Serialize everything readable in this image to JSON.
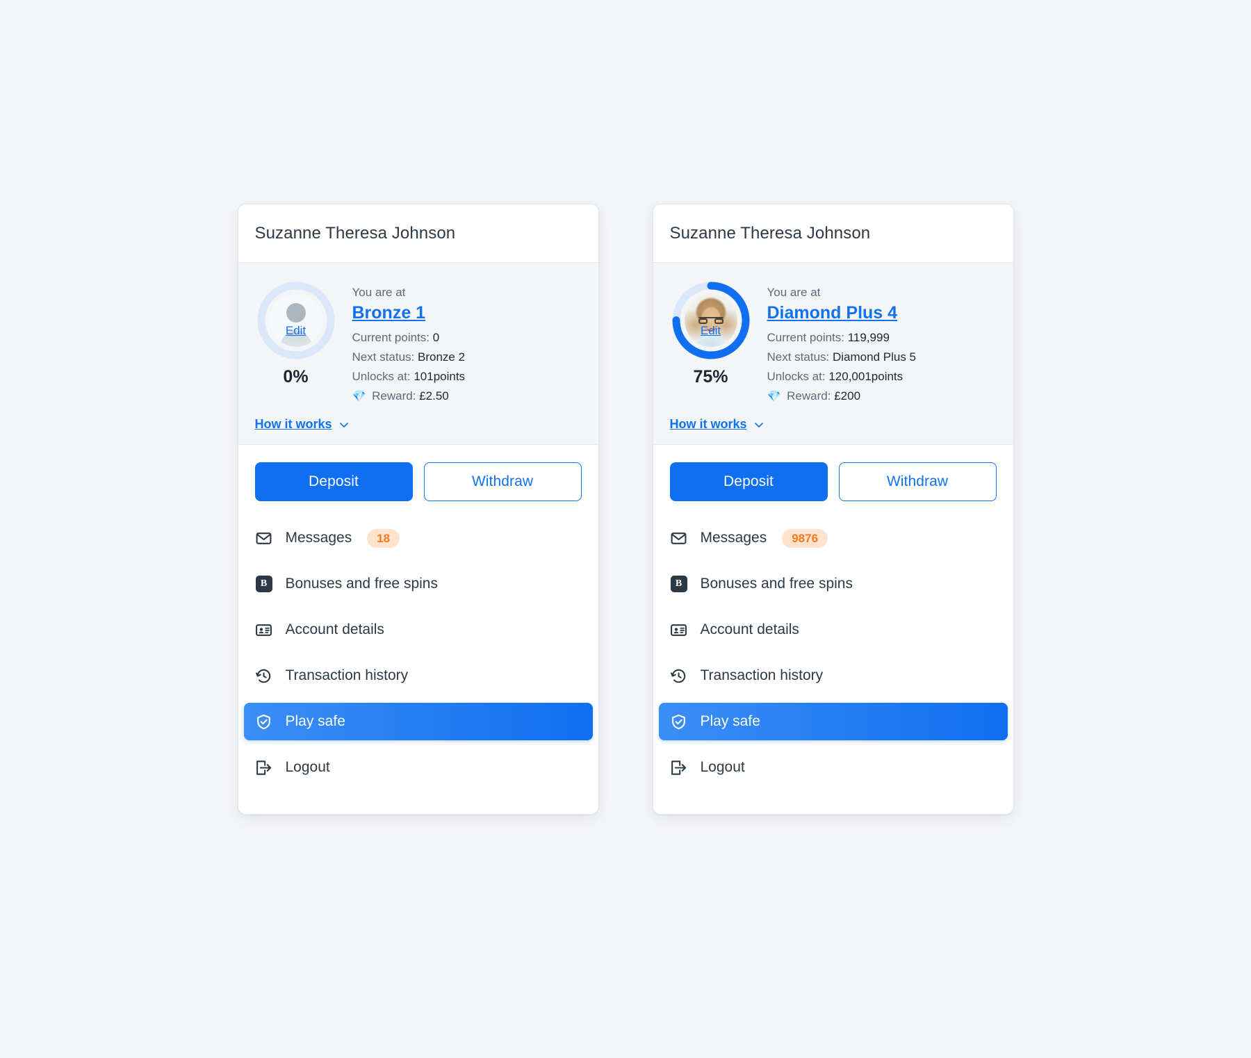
{
  "page": {
    "background_color": "#f4f5f7",
    "accent_color": "#1172f0",
    "badge_bg_color": "#ffe3cd",
    "badge_text_color": "#f47b20"
  },
  "cards": [
    {
      "user_name": "Suzanne Theresa Johnson",
      "avatar": {
        "type": "placeholder",
        "edit_label": "Edit"
      },
      "progress": {
        "percent_label": "0%",
        "percent_value": 0
      },
      "loyalty": {
        "you_are_at_label": "You are at",
        "tier_label": "Bronze 1",
        "current_points_label": "Current points:",
        "current_points_value": "0",
        "next_status_label": "Next status:",
        "next_status_value": "Bronze 2",
        "unlocks_at_label": "Unlocks at:",
        "unlocks_at_value": "101points",
        "reward_icon": "diamond-icon",
        "reward_label": "Reward:",
        "reward_value": "£2.50",
        "how_it_works_label": "How it works"
      },
      "actions": {
        "deposit_label": "Deposit",
        "withdraw_label": "Withdraw"
      },
      "menu": [
        {
          "icon": "envelope-icon",
          "label": "Messages",
          "badge": "18",
          "active": false
        },
        {
          "icon": "bonus-b-icon",
          "label": "Bonuses and free spins",
          "badge": null,
          "active": false
        },
        {
          "icon": "id-card-icon",
          "label": "Account details",
          "badge": null,
          "active": false
        },
        {
          "icon": "history-clock-icon",
          "label": "Transaction history",
          "badge": null,
          "active": false
        },
        {
          "icon": "shield-check-icon",
          "label": "Play safe",
          "badge": null,
          "active": true
        },
        {
          "icon": "logout-arrow-icon",
          "label": "Logout",
          "badge": null,
          "active": false
        }
      ]
    },
    {
      "user_name": "Suzanne Theresa Johnson",
      "avatar": {
        "type": "photo",
        "edit_label": "Edit"
      },
      "progress": {
        "percent_label": "75%",
        "percent_value": 75
      },
      "loyalty": {
        "you_are_at_label": "You are at",
        "tier_label": "Diamond Plus 4",
        "current_points_label": "Current points:",
        "current_points_value": "119,999",
        "next_status_label": "Next status:",
        "next_status_value": "Diamond Plus 5",
        "unlocks_at_label": "Unlocks at:",
        "unlocks_at_value": "120,001points",
        "reward_icon": "diamond-icon",
        "reward_label": "Reward:",
        "reward_value": "£200",
        "how_it_works_label": "How it works"
      },
      "actions": {
        "deposit_label": "Deposit",
        "withdraw_label": "Withdraw"
      },
      "menu": [
        {
          "icon": "envelope-icon",
          "label": "Messages",
          "badge": "9876",
          "active": false
        },
        {
          "icon": "bonus-b-icon",
          "label": "Bonuses and free spins",
          "badge": null,
          "active": false
        },
        {
          "icon": "id-card-icon",
          "label": "Account details",
          "badge": null,
          "active": false
        },
        {
          "icon": "history-clock-icon",
          "label": "Transaction history",
          "badge": null,
          "active": false
        },
        {
          "icon": "shield-check-icon",
          "label": "Play safe",
          "badge": null,
          "active": true
        },
        {
          "icon": "logout-arrow-icon",
          "label": "Logout",
          "badge": null,
          "active": false
        }
      ]
    }
  ]
}
